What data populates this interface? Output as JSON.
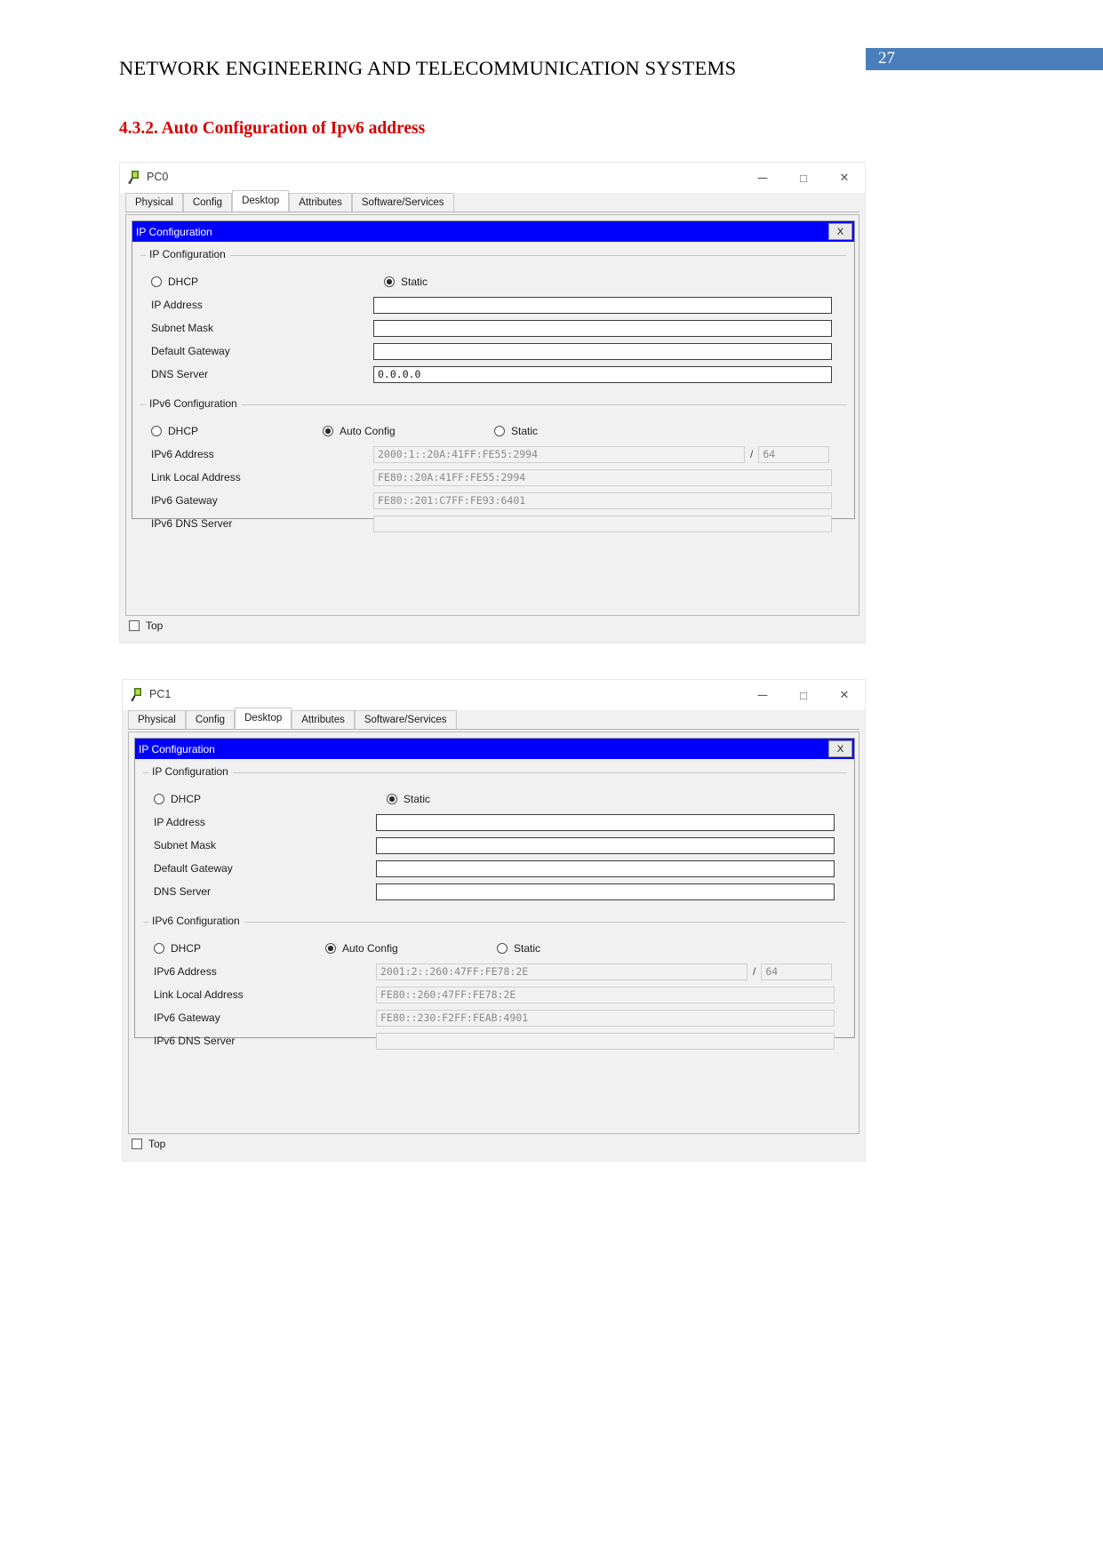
{
  "document": {
    "header_title": "NETWORK ENGINEERING AND TELECOMMUNICATION SYSTEMS",
    "page_number": "27",
    "page_badge_color": "#4a7ebb",
    "section_heading": "4.3.2. Auto Configuration of Ipv6 address",
    "heading_color": "#d40000"
  },
  "common": {
    "tabs": [
      "Physical",
      "Config",
      "Desktop",
      "Attributes",
      "Software/Services"
    ],
    "active_tab": "Desktop",
    "window_buttons": {
      "minimize": "─",
      "maximize": "□",
      "close": "✕"
    },
    "dialog_title": "IP Configuration",
    "dialog_title_color": "#0000ff",
    "dialog_close_label": "X",
    "ipv4_group_legend": "IP Configuration",
    "ipv6_group_legend": "IPv6 Configuration",
    "ipv4_dhcp_label": "DHCP",
    "ipv4_static_label": "Static",
    "ipv6_dhcp_label": "DHCP",
    "ipv6_auto_label": "Auto Config",
    "ipv6_static_label": "Static",
    "labels": {
      "ip_address": "IP Address",
      "subnet_mask": "Subnet Mask",
      "default_gateway": "Default Gateway",
      "dns_server": "DNS Server",
      "ipv6_address": "IPv6 Address",
      "link_local_address": "Link Local Address",
      "ipv6_gateway": "IPv6 Gateway",
      "ipv6_dns_server": "IPv6 DNS Server"
    },
    "prefix_separator": "/",
    "top_checkbox_label": "Top"
  },
  "pc0": {
    "window_title": "PC0",
    "ipv4": {
      "dhcp_selected": false,
      "static_selected": true,
      "ip_address": "",
      "subnet_mask": "",
      "default_gateway": "",
      "dns_server": "0.0.0.0"
    },
    "ipv6": {
      "dhcp_selected": false,
      "auto_config_selected": true,
      "static_selected": false,
      "ipv6_address": "2000:1::20A:41FF:FE55:2994",
      "prefix_length": "64",
      "link_local_address": "FE80::20A:41FF:FE55:2994",
      "ipv6_gateway": "FE80::201:C7FF:FE93:6401",
      "ipv6_dns_server": ""
    }
  },
  "pc1": {
    "window_title": "PC1",
    "ipv4": {
      "dhcp_selected": false,
      "static_selected": true,
      "ip_address": "",
      "subnet_mask": "",
      "default_gateway": "",
      "dns_server": ""
    },
    "ipv6": {
      "dhcp_selected": false,
      "auto_config_selected": true,
      "static_selected": false,
      "ipv6_address": "2001:2::260:47FF:FE78:2E",
      "prefix_length": "64",
      "link_local_address": "FE80::260:47FF:FE78:2E",
      "ipv6_gateway": "FE80::230:F2FF:FEAB:4901",
      "ipv6_dns_server": ""
    }
  }
}
